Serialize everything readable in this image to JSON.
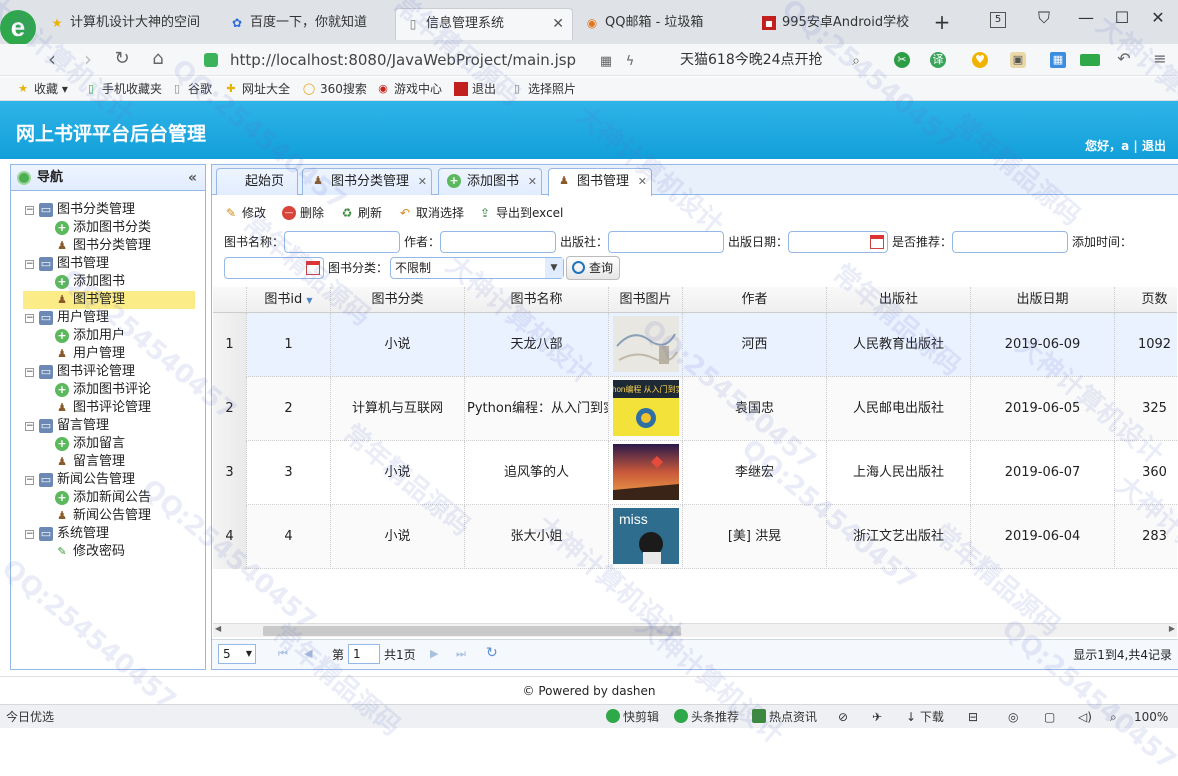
{
  "browser": {
    "tabs": [
      {
        "label": "计算机设计大神的空间",
        "icon": "star-icon"
      },
      {
        "label": "百度一下，你就知道",
        "icon": "baidu-paw-icon"
      },
      {
        "label": "信息管理系统",
        "icon": "page-icon",
        "active": true
      },
      {
        "label": "QQ邮箱 - 垃圾箱",
        "icon": "qq-mail-icon"
      },
      {
        "label": "995安卓Android学校",
        "icon": "red-square-icon"
      }
    ],
    "new_tab": "+",
    "tab_count": "5",
    "url": "http://localhost:8080/JavaWebProject/main.jsp",
    "promo": "天猫618今晚24点开抢",
    "bookmarks": [
      "收藏",
      "手机收藏夹",
      "谷歌",
      "网址大全",
      "360搜索",
      "游戏中心",
      "退出",
      "选择照片"
    ]
  },
  "app": {
    "title": "网上书评平台后台管理",
    "user_greeting": "您好，a | 退出"
  },
  "sidebar": {
    "title": "导航",
    "collapse_icon": "«",
    "groups": [
      {
        "label": "图书分类管理",
        "items": [
          {
            "label": "添加图书分类",
            "icon": "add"
          },
          {
            "label": "图书分类管理",
            "icon": "user"
          }
        ]
      },
      {
        "label": "图书管理",
        "items": [
          {
            "label": "添加图书",
            "icon": "add"
          },
          {
            "label": "图书管理",
            "icon": "user",
            "selected": true
          }
        ]
      },
      {
        "label": "用户管理",
        "items": [
          {
            "label": "添加用户",
            "icon": "add"
          },
          {
            "label": "用户管理",
            "icon": "user"
          }
        ]
      },
      {
        "label": "图书评论管理",
        "items": [
          {
            "label": "添加图书评论",
            "icon": "add"
          },
          {
            "label": "图书评论管理",
            "icon": "user"
          }
        ]
      },
      {
        "label": "留言管理",
        "items": [
          {
            "label": "添加留言",
            "icon": "add"
          },
          {
            "label": "留言管理",
            "icon": "user"
          }
        ]
      },
      {
        "label": "新闻公告管理",
        "items": [
          {
            "label": "添加新闻公告",
            "icon": "add"
          },
          {
            "label": "新闻公告管理",
            "icon": "user"
          }
        ]
      },
      {
        "label": "系统管理",
        "items": [
          {
            "label": "修改密码",
            "icon": "pen"
          }
        ]
      }
    ]
  },
  "panel_tabs": [
    {
      "label": "起始页"
    },
    {
      "label": "图书分类管理",
      "closable": true
    },
    {
      "label": "添加图书",
      "closable": true
    },
    {
      "label": "图书管理",
      "closable": true,
      "active": true
    }
  ],
  "toolbar": {
    "edit": "修改",
    "delete": "删除",
    "refresh": "刷新",
    "deselect": "取消选择",
    "export": "导出到excel"
  },
  "search": {
    "book_name_label": "图书名称：",
    "author_label": "作者：",
    "publisher_label": "出版社：",
    "publish_date_label": "出版日期：",
    "recommend_label": "是否推荐：",
    "add_time_label": "添加时间：",
    "category_label": "图书分类：",
    "category_value": "不限制",
    "query_button": "查询"
  },
  "table": {
    "columns": [
      "图书id",
      "图书分类",
      "图书名称",
      "图书图片",
      "作者",
      "出版社",
      "出版日期",
      "页数"
    ],
    "rows": [
      {
        "rownum": "1",
        "id": "1",
        "category": "小说",
        "name": "天龙八部",
        "author": "河西",
        "publisher": "人民教育出版社",
        "date": "2019-06-09",
        "pages": "1092"
      },
      {
        "rownum": "2",
        "id": "2",
        "category": "计算机与互联网",
        "name": "Python编程：从入门到实践",
        "author": "袁国忠",
        "publisher": "人民邮电出版社",
        "date": "2019-06-05",
        "pages": "325"
      },
      {
        "rownum": "3",
        "id": "3",
        "category": "小说",
        "name": "追风筝的人",
        "author": "李继宏",
        "publisher": "上海人民出版社",
        "date": "2019-06-07",
        "pages": "360"
      },
      {
        "rownum": "4",
        "id": "4",
        "category": "小说",
        "name": "张大小姐",
        "author": "[美] 洪晃",
        "publisher": "浙江文艺出版社",
        "date": "2019-06-04",
        "pages": "283"
      }
    ],
    "cover_texts": [
      "Python编程 从入门到实践",
      "miss"
    ]
  },
  "pager": {
    "page_size": "5",
    "page_prefix": "第",
    "page_value": "1",
    "page_total": "共1页",
    "info": "显示1到4,共4记录"
  },
  "footer": "© Powered by dashen",
  "statusbar": {
    "left": "今日优选",
    "items": [
      "快剪辑",
      "头条推荐",
      "热点资讯",
      "下载"
    ],
    "zoom": "100%"
  },
  "watermarks": [
    "大神计算机设计",
    "QQ:254540457",
    "常年精品源码"
  ]
}
